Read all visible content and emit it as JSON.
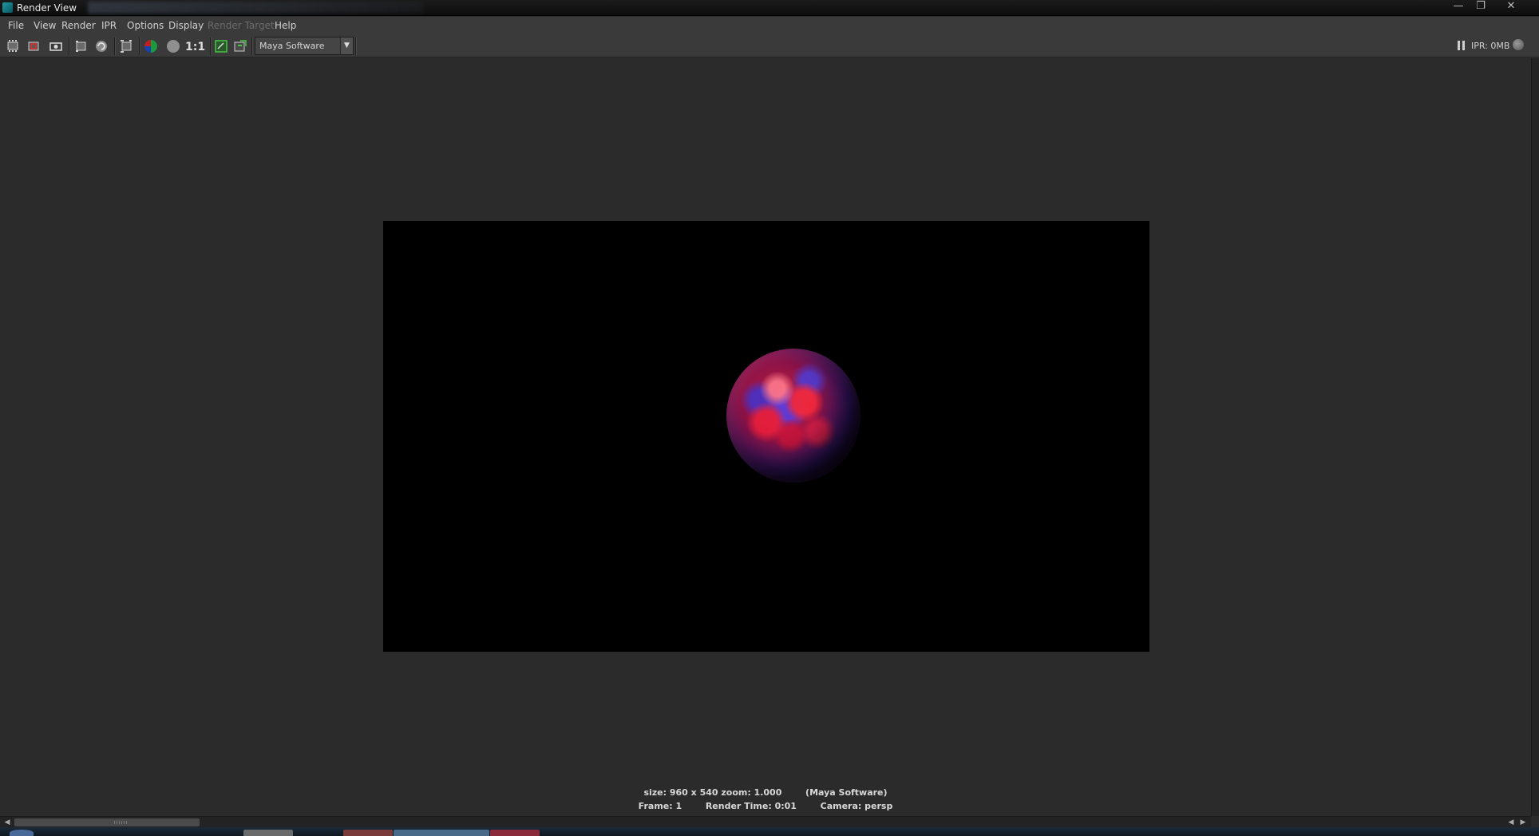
{
  "window": {
    "title": "Render View"
  },
  "menu": {
    "items": [
      {
        "label": "File",
        "enabled": true
      },
      {
        "label": "View",
        "enabled": true
      },
      {
        "label": "Render",
        "enabled": true
      },
      {
        "label": "IPR",
        "enabled": true
      },
      {
        "label": "Options",
        "enabled": true
      },
      {
        "label": "Display",
        "enabled": true
      },
      {
        "label": "Render Target",
        "enabled": false
      },
      {
        "label": "Help",
        "enabled": true
      }
    ]
  },
  "toolbar": {
    "icons": [
      "redo-render-icon",
      "render-region-icon",
      "snapshot-icon",
      "ipr-render-icon",
      "refresh-ipr-icon",
      "render-settings-icon",
      "rgb-channels-icon",
      "alpha-channel-icon",
      "real-size-icon",
      "keep-image-icon",
      "remove-image-icon"
    ],
    "real_size_label": "1:1",
    "renderer": "Maya Software",
    "ipr_label": "IPR: 0MB"
  },
  "status": {
    "size": "size: 960 x 540 zoom: 1.000",
    "renderer": "(Maya Software)",
    "frame": "Frame: 1",
    "render_time": "Render Time: 0:01",
    "camera": "Camera: persp"
  },
  "colors": {
    "background": "#2b2b2b",
    "menubar": "#3a3a3a",
    "render_background": "#000000",
    "sphere_red": "#c8203a",
    "sphere_blue": "#4a3ad0"
  }
}
